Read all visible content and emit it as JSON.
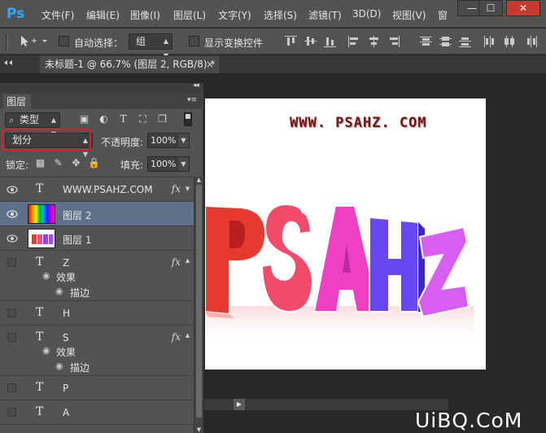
{
  "app": {
    "logo": "Ps"
  },
  "menu": [
    "文件(F)",
    "编辑(E)",
    "图像(I)",
    "图层(L)",
    "文字(Y)",
    "选择(S)",
    "滤镜(T)",
    "3D(D)",
    "视图(V)",
    "窗"
  ],
  "window_controls": {
    "minimize": "—",
    "maximize": "☐",
    "close": "✕"
  },
  "options": {
    "auto_select_label": "自动选择：",
    "auto_select_value": "组",
    "show_transform_label": "显示变换控件"
  },
  "document_tab": {
    "title": "未标题-1 @ 66.7% (图层 2, RGB/8) *",
    "close": "×"
  },
  "layers_panel": {
    "tab_label": "图层",
    "filter_value": "类型",
    "blend_mode": "划分",
    "opacity_label": "不透明度:",
    "opacity_value": "100%",
    "lock_label": "锁定:",
    "fill_label": "填充:",
    "fill_value": "100%",
    "layers": [
      {
        "name": "WWW.PSAHZ.COM",
        "kind": "text",
        "visible": true,
        "fx": "fx"
      },
      {
        "name": "图层 2",
        "kind": "gradient",
        "visible": true,
        "selected": true
      },
      {
        "name": "图层 1",
        "kind": "image",
        "visible": true
      },
      {
        "name": "Z",
        "kind": "text",
        "visible": false,
        "fx": "fx",
        "effects_label": "效果",
        "effect": "描边"
      },
      {
        "name": "H",
        "kind": "text",
        "visible": false
      },
      {
        "name": "S",
        "kind": "text",
        "visible": false,
        "fx": "fx",
        "effects_label": "效果",
        "effect": "描边"
      },
      {
        "name": "P",
        "kind": "text",
        "visible": false
      },
      {
        "name": "A",
        "kind": "text",
        "visible": false
      }
    ]
  },
  "canvas": {
    "watermark": "WWW. PSAHZ. COM",
    "artwork_letters": [
      "P",
      "S",
      "A",
      "H",
      "Z"
    ],
    "artwork_colors": [
      "#e8322e",
      "#f23c6c",
      "#ee3cc8",
      "#6a3cf0",
      "#d050f0"
    ]
  },
  "brand": "UiBQ.CoM"
}
